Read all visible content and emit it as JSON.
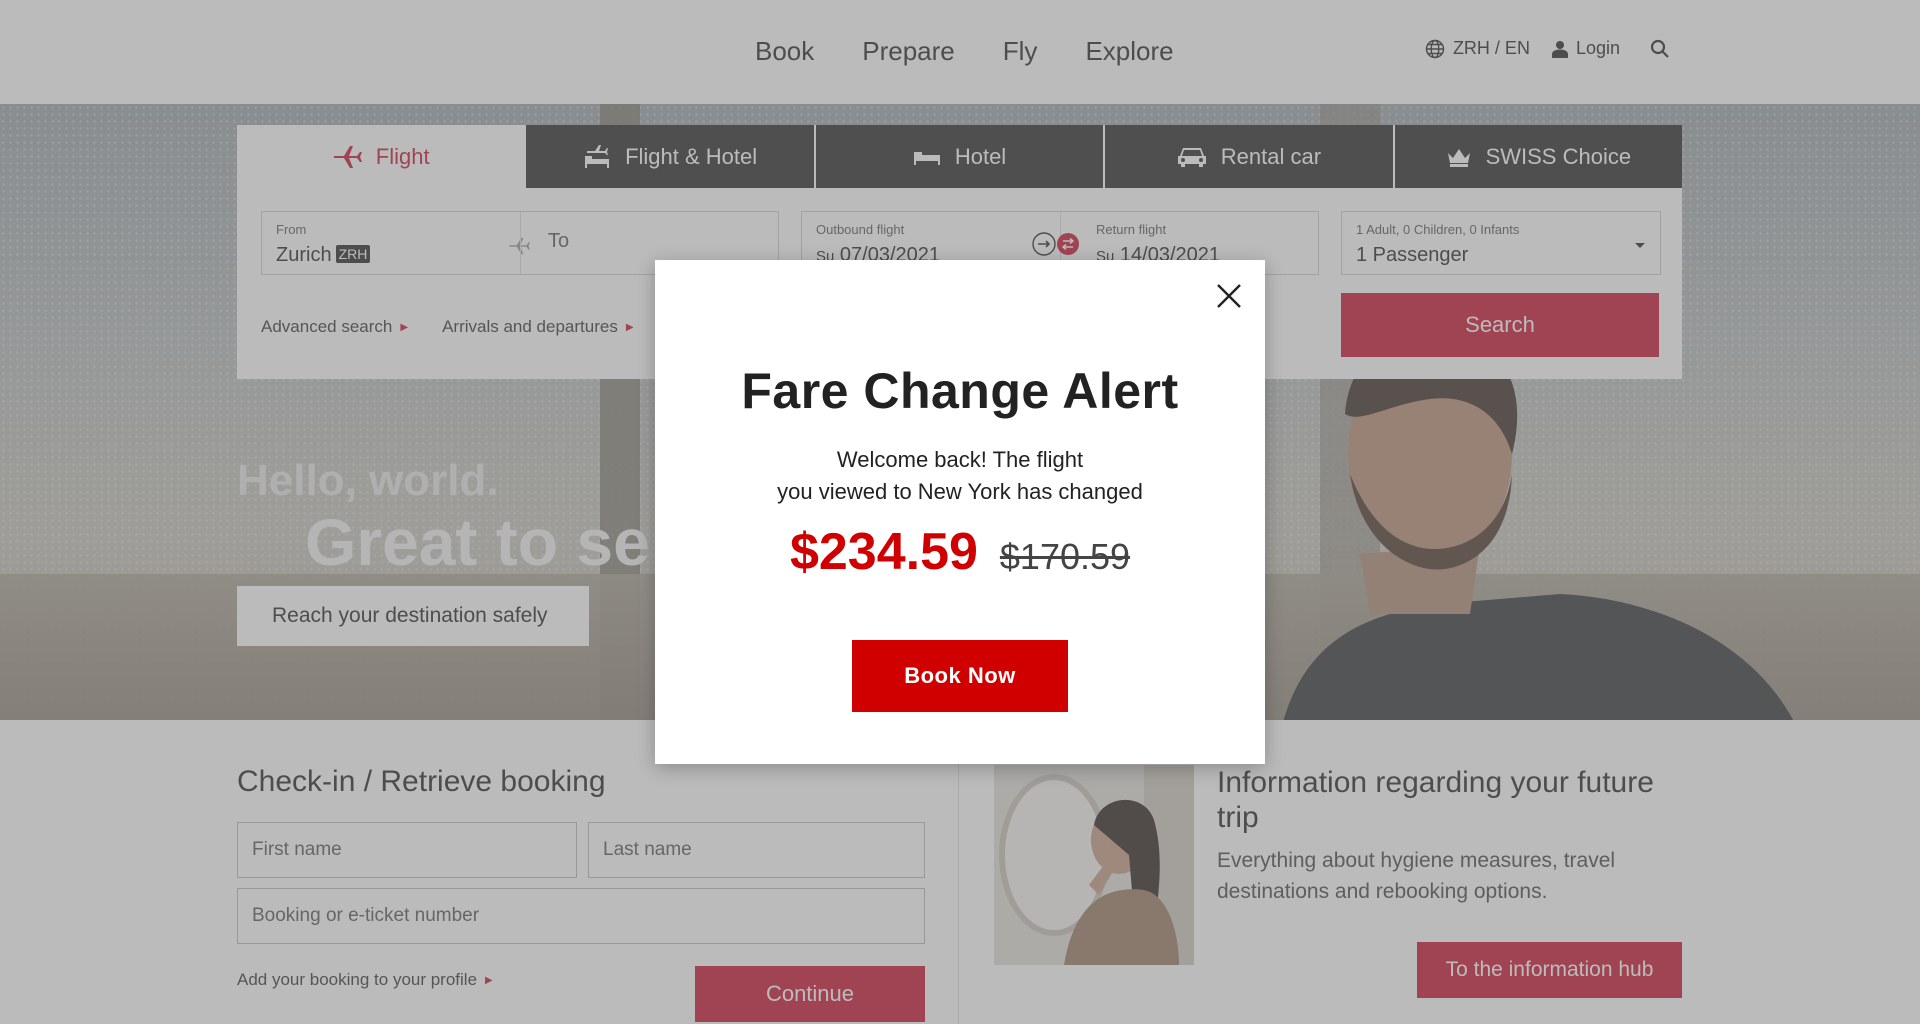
{
  "header": {
    "nav": [
      "Book",
      "Prepare",
      "Fly",
      "Explore"
    ],
    "locale": "ZRH / EN",
    "login": "Login"
  },
  "booking": {
    "tabs": [
      {
        "label": "Flight",
        "icon": "plane-icon",
        "active": true
      },
      {
        "label": "Flight & Hotel",
        "icon": "plane-bed-icon"
      },
      {
        "label": "Hotel",
        "icon": "bed-icon"
      },
      {
        "label": "Rental car",
        "icon": "car-icon"
      },
      {
        "label": "SWISS Choice",
        "icon": "crown-icon"
      }
    ],
    "from_label": "From",
    "from_value": "Zurich",
    "from_code": "ZRH",
    "to_placeholder": "To",
    "outbound_label": "Outbound flight",
    "outbound_day": "Su",
    "outbound_date": "07/03/2021",
    "return_label": "Return flight",
    "return_day": "Su",
    "return_date": "14/03/2021",
    "passengers_label": "1 Adult, 0 Children, 0 Infants",
    "passengers_value": "1 Passenger",
    "search_label": "Search",
    "advanced_search": "Advanced search",
    "arrivals_departures": "Arrivals and departures"
  },
  "hero": {
    "hello": "Hello, world.",
    "headline": "Great to se",
    "cta": "Reach your destination safely"
  },
  "checkin": {
    "title": "Check-in / Retrieve booking",
    "first_name_placeholder": "First name",
    "last_name_placeholder": "Last name",
    "booking_placeholder": "Booking or e-ticket number",
    "add_booking": "Add your booking to your profile",
    "continue_label": "Continue"
  },
  "info": {
    "title": "Information regarding your future trip",
    "description": "Everything about hygiene measures, travel destinations and rebooking options.",
    "button": "To the information hub"
  },
  "modal": {
    "title": "Fare Change Alert",
    "message_line1": "Welcome back! The flight",
    "message_line2": "you viewed to New York has changed",
    "new_price": "$234.59",
    "old_price": "$170.59",
    "button": "Book Now"
  },
  "colors": {
    "brand_red": "#c8102e",
    "alert_red": "#d00000",
    "tab_dark": "#262626"
  }
}
